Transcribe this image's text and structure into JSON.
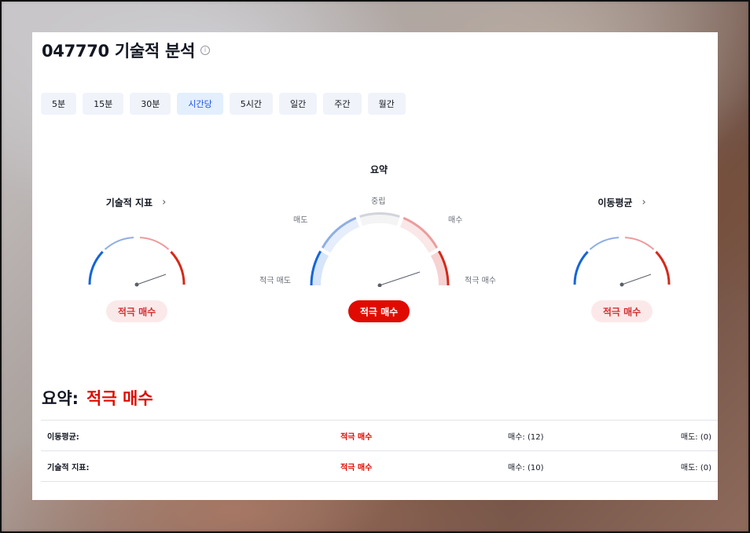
{
  "header": {
    "title": "047770 기술적 분석",
    "info_glyph": "i"
  },
  "tabs": [
    {
      "label": "5분",
      "active": false
    },
    {
      "label": "15분",
      "active": false
    },
    {
      "label": "30분",
      "active": false
    },
    {
      "label": "시간당",
      "active": true
    },
    {
      "label": "5시간",
      "active": false
    },
    {
      "label": "일간",
      "active": false
    },
    {
      "label": "주간",
      "active": false
    },
    {
      "label": "월간",
      "active": false
    }
  ],
  "gauges": {
    "oscillators": {
      "title": "기술적 지표",
      "chevron": "›",
      "result": "적극 매수"
    },
    "summary": {
      "title": "요약",
      "result": "적극 매수",
      "labels": {
        "strong_sell": "적극 매도",
        "sell": "매도",
        "neutral": "중립",
        "buy": "매수",
        "strong_buy": "적극 매수"
      }
    },
    "moving_averages": {
      "title": "이동평균",
      "chevron": "›",
      "result": "적극 매수"
    }
  },
  "summary_line": {
    "label": "요약:",
    "value": "적극 매수"
  },
  "table": [
    {
      "name": "이동평균:",
      "verdict": "적극 매수",
      "buy": "매수: (12)",
      "sell": "매도: (0)"
    },
    {
      "name": "기술적 지표:",
      "verdict": "적극 매수",
      "buy": "매수: (10)",
      "sell": "매도: (0)"
    }
  ],
  "colors": {
    "strong_sell": "#1565d8",
    "sell": "#8eaee3",
    "neutral": "#d1d4dc",
    "buy": "#ec9c9c",
    "strong_buy": "#d42a1a",
    "needle": "#5b5f6b",
    "accent": "#e00b00"
  }
}
